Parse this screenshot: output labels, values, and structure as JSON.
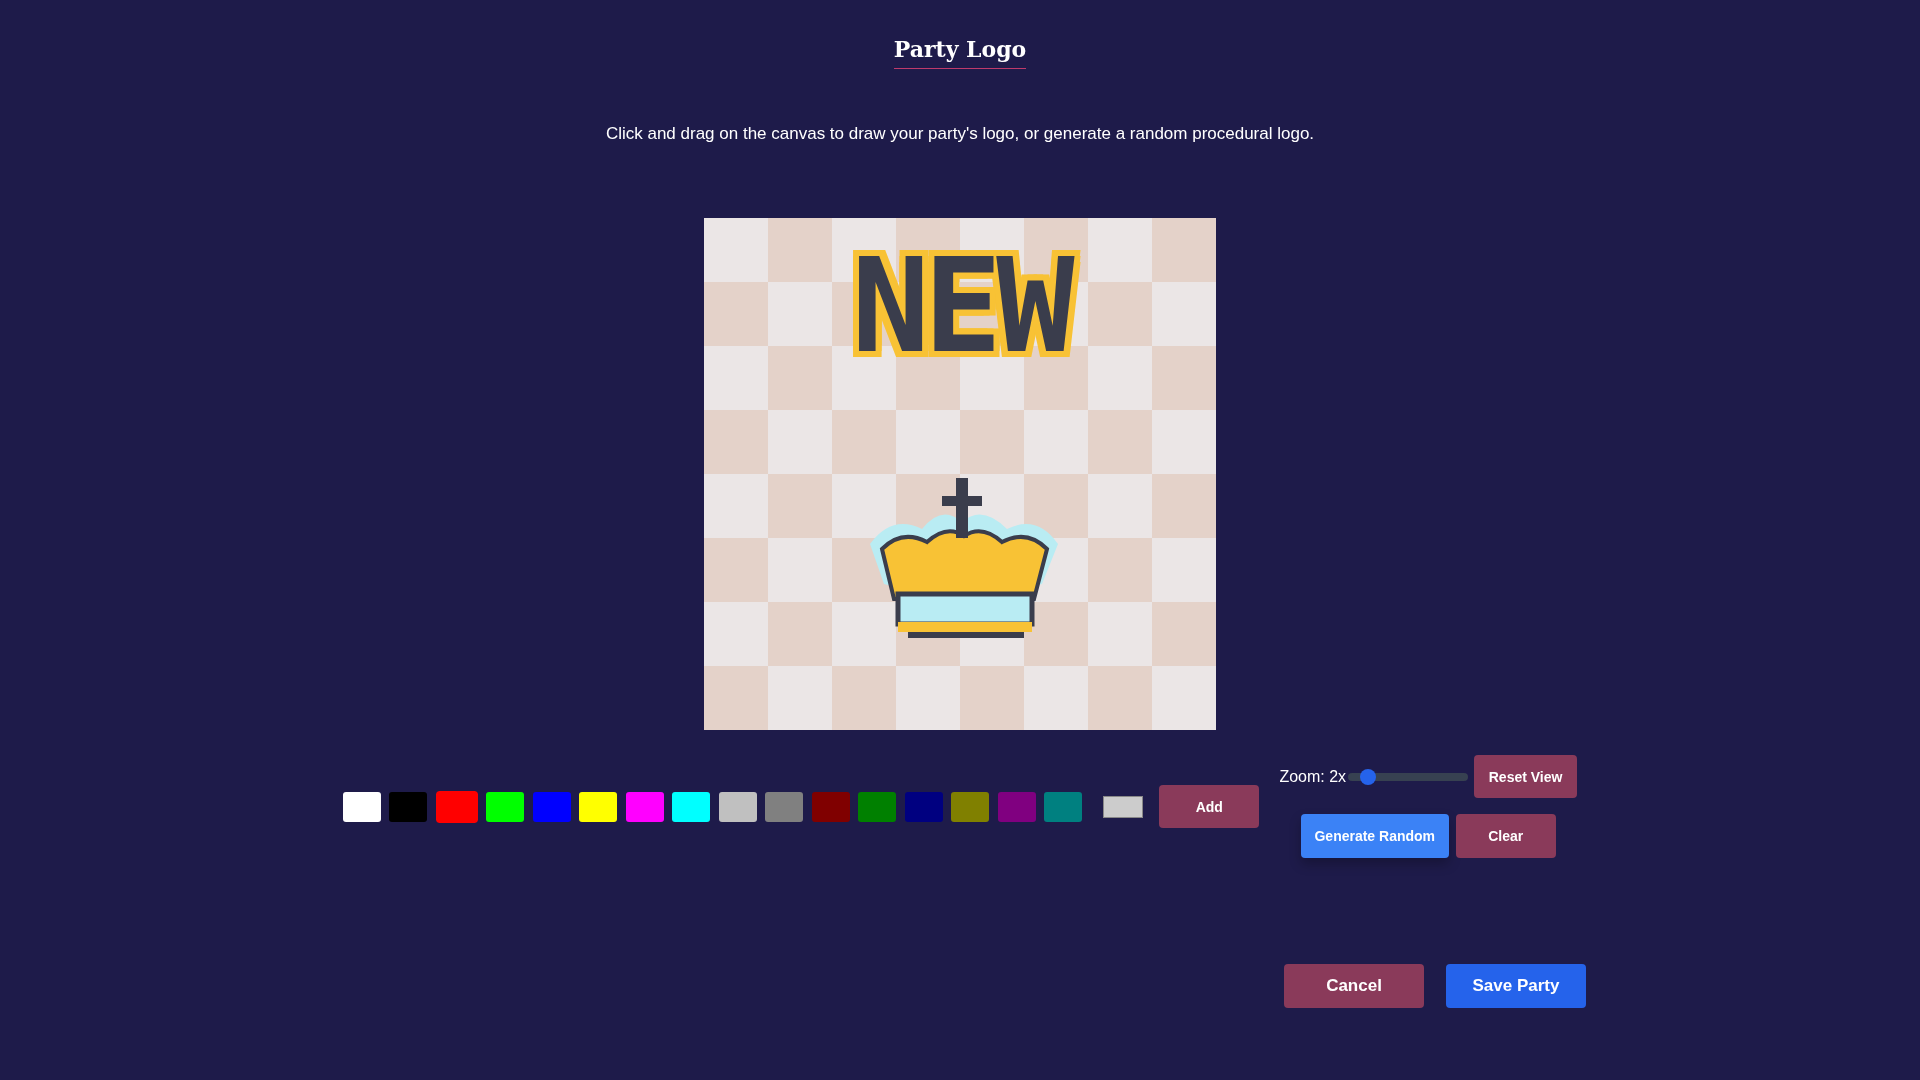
{
  "title": "Party Logo",
  "instructions": "Click and drag on the canvas to draw your party's logo, or generate a random procedural logo.",
  "canvas": {
    "logo_text": "NEW"
  },
  "palette": [
    {
      "color": "#ffffff",
      "selected": false
    },
    {
      "color": "#000000",
      "selected": false
    },
    {
      "color": "#ff0000",
      "selected": true
    },
    {
      "color": "#00ff00",
      "selected": false
    },
    {
      "color": "#0000ff",
      "selected": false
    },
    {
      "color": "#ffff00",
      "selected": false
    },
    {
      "color": "#ff00ff",
      "selected": false
    },
    {
      "color": "#00ffff",
      "selected": false
    },
    {
      "color": "#c0c0c0",
      "selected": false
    },
    {
      "color": "#808080",
      "selected": false
    },
    {
      "color": "#800000",
      "selected": false
    },
    {
      "color": "#008000",
      "selected": false
    },
    {
      "color": "#000080",
      "selected": false
    },
    {
      "color": "#808000",
      "selected": false
    },
    {
      "color": "#800080",
      "selected": false
    },
    {
      "color": "#008080",
      "selected": false
    }
  ],
  "custom_color": {
    "color": "#cccccc"
  },
  "add_button": "Add",
  "zoom": {
    "label": "Zoom: 2x",
    "level": 0.1
  },
  "reset_button": "Reset View",
  "generate_button": "Generate Random",
  "clear_button": "Clear",
  "cancel_button": "Cancel",
  "save_button": "Save Party"
}
